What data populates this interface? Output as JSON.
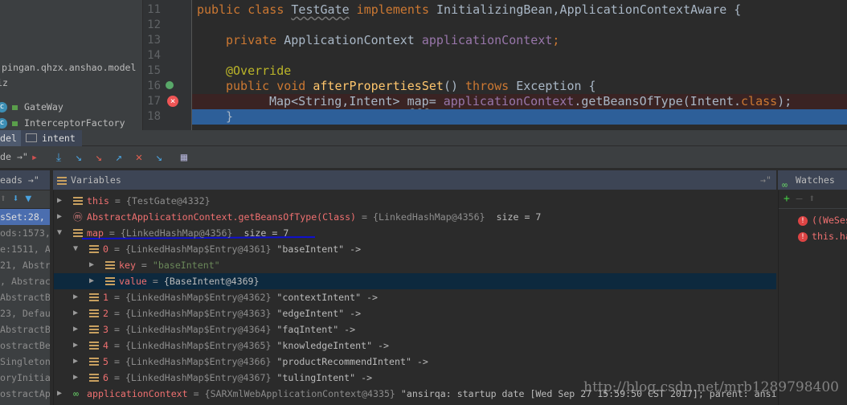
{
  "project": {
    "package": "pingan.qhzx.anshao.model",
    "folder": "iz",
    "classes": [
      "GateWay",
      "InterceptorFactory"
    ]
  },
  "editor": {
    "line_numbers": [
      "11",
      "12",
      "13",
      "14",
      "15",
      "16",
      "17",
      "18"
    ],
    "lines": {
      "l11": {
        "kw1": "public class ",
        "cls": "TestGate",
        "kw2": " implements ",
        "rest": "InitializingBean,ApplicationContextAware {"
      },
      "l13": {
        "kw": "private ",
        "type": "ApplicationContext ",
        "field": "applicationContext",
        "semi": ";"
      },
      "l15": {
        "ann": "@Override"
      },
      "l16": {
        "kw": "public void ",
        "fn": "afterPropertiesSet",
        "mid": "() ",
        "kw2": "throws ",
        "rest": "Exception {"
      },
      "l17": {
        "pre": "Map<String,Intent> ",
        "var": "map",
        "eq": "= ",
        "field": "applicationContext",
        "call": ".getBeansOfType(Intent.",
        "kw": "class",
        "end": ");"
      },
      "l18": {
        "brace": "}"
      }
    }
  },
  "tabs": [
    {
      "label": "del"
    },
    {
      "label": "intent"
    }
  ],
  "toolbar": {
    "left_label": "de"
  },
  "panels": {
    "threads": "eads",
    "variables": "Variables",
    "watches": "Watches"
  },
  "frames": [
    "sSet:28, T",
    "ods:1573,",
    "e:1511, Abs",
    "21, Abstra",
    ", Abstract",
    " AbstractB",
    "23, Defaul",
    " AbstractB",
    "ostractBea",
    "Singletons",
    "oryInitial",
    "ostractApp"
  ],
  "variables": [
    {
      "name": "this",
      "value": "{TestGate@4332}",
      "extra": ""
    },
    {
      "name": "AbstractApplicationContext.getBeansOfType(Class)",
      "value": "{LinkedHashMap@4356}",
      "extra": "  size = 7"
    },
    {
      "name": "map",
      "value": "{LinkedHashMap@4356}",
      "extra": "  size = 7"
    },
    {
      "name": "0",
      "value": "{LinkedHashMap$Entry@4361}",
      "extra": " \"baseIntent\" ->"
    },
    {
      "name": "key",
      "value": "",
      "str": "\"baseIntent\""
    },
    {
      "name": "value",
      "value": "{BaseIntent@4369}",
      "extra": ""
    },
    {
      "name": "1",
      "value": "{LinkedHashMap$Entry@4362}",
      "extra": " \"contextIntent\" ->"
    },
    {
      "name": "2",
      "value": "{LinkedHashMap$Entry@4363}",
      "extra": " \"edgeIntent\" ->"
    },
    {
      "name": "3",
      "value": "{LinkedHashMap$Entry@4364}",
      "extra": " \"faqIntent\" ->"
    },
    {
      "name": "4",
      "value": "{LinkedHashMap$Entry@4365}",
      "extra": " \"knowledgeIntent\" ->"
    },
    {
      "name": "5",
      "value": "{LinkedHashMap$Entry@4366}",
      "extra": " \"productRecommendIntent\" ->"
    },
    {
      "name": "6",
      "value": "{LinkedHashMap$Entry@4367}",
      "extra": " \"tulingIntent\" ->"
    },
    {
      "name": "applicationContext",
      "value": "{SARXmlWebApplicationContext@4335}",
      "extra": " \"ansirqa: startup date [Wed Sep 27 15:59:50 CST 2017]; parent: ansi"
    }
  ],
  "watches": [
    "((WeSes",
    "this.ha"
  ],
  "watermark": "http://blog.csdn.net/mrb1289798400"
}
